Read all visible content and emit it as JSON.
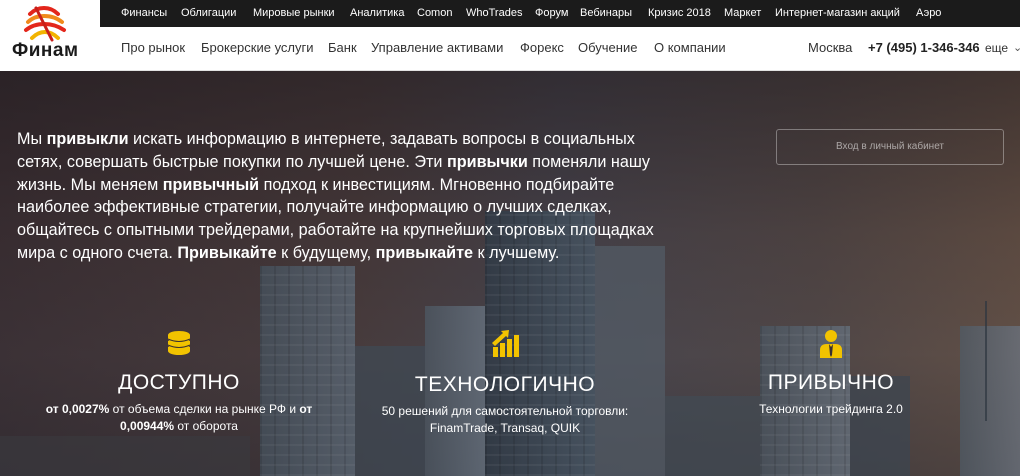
{
  "brand": {
    "name": "Финам",
    "accent": "#e3261b",
    "icon_accent": "#f2c300"
  },
  "topbar": {
    "links": [
      "Финансы",
      "Облигации",
      "Мировые рынки",
      "Аналитика",
      "Comon",
      "WhoTrades",
      "Форум",
      "Вебинары",
      "Кризис 2018",
      "Маркет",
      "Интернет-магазин акций",
      "Аэро"
    ]
  },
  "mainnav": {
    "links": [
      "Про рынок",
      "Брокерские услуги",
      "Банк",
      "Управление активами",
      "Форекс",
      "Обучение",
      "О компании"
    ],
    "city": "Москва",
    "phone": "+7 (495) 1-346-346",
    "more": "еще"
  },
  "hero": {
    "intro": [
      {
        "t": "Мы ",
        "b": false
      },
      {
        "t": "привыкли",
        "b": true
      },
      {
        "t": " искать информацию в интернете, задавать вопросы в социальных сетях, совершать быстрые покупки по лучшей цене. Эти ",
        "b": false
      },
      {
        "t": "привычки",
        "b": true
      },
      {
        "t": " поменяли нашу жизнь. Мы меняем ",
        "b": false
      },
      {
        "t": "привычный",
        "b": true
      },
      {
        "t": " подход к инвестициям. Мгновенно подбирайте наиболее эффективные стратегии, получайте информацию о лучших сделках, общайтесь с опытными трейдерами, работайте на крупнейших торговых площадках мира с одного счета. ",
        "b": false
      },
      {
        "t": "Привыкайте",
        "b": true
      },
      {
        "t": " к будущему, ",
        "b": false
      },
      {
        "t": "привыкайте",
        "b": true
      },
      {
        "t": " к лучшему.",
        "b": false
      }
    ],
    "login_button": "Вход в личный кабинет"
  },
  "features": [
    {
      "icon": "coins-icon",
      "title": "ДОСТУПНО",
      "desc": [
        {
          "t": "от 0,0027%",
          "b": true
        },
        {
          "t": " от объема сделки на рынке РФ и ",
          "b": false
        },
        {
          "t": "от 0,00944%",
          "b": true
        },
        {
          "t": " от оборота",
          "b": false
        }
      ]
    },
    {
      "icon": "growth-chart-icon",
      "title": "ТЕХНОЛОГИЧНО",
      "desc": [
        {
          "t": "50 решений для самостоятельной торговли: FinamTrade, Transaq, QUIK",
          "b": false
        }
      ]
    },
    {
      "icon": "businessman-icon",
      "title": "ПРИВЫЧНО",
      "desc": [
        {
          "t": "Технологии трейдинга 2.0",
          "b": false
        }
      ]
    }
  ]
}
